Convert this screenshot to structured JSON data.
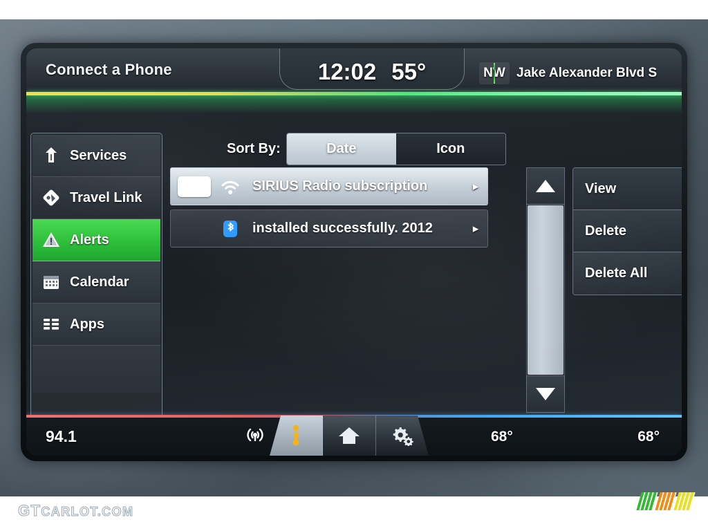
{
  "header": {
    "title": "Connect a Phone",
    "clock": "12:02",
    "outside_temp": "55°",
    "compass": "NW",
    "street": "Jake Alexander Blvd S"
  },
  "sidebar": {
    "items": [
      {
        "label": "Services",
        "icon": "road-sign-icon",
        "active": false
      },
      {
        "label": "Travel Link",
        "icon": "diamond-map-icon",
        "active": false
      },
      {
        "label": "Alerts",
        "icon": "warning-triangle-icon",
        "active": true
      },
      {
        "label": "Calendar",
        "icon": "calendar-icon",
        "active": false
      },
      {
        "label": "Apps",
        "icon": "apps-grid-icon",
        "active": false
      }
    ]
  },
  "sort": {
    "label": "Sort By:",
    "options": [
      {
        "label": "Date",
        "selected": true
      },
      {
        "label": "Icon",
        "selected": false
      }
    ]
  },
  "messages": [
    {
      "text": "SIRIUS Radio subscription",
      "icon": "sirius-signal-icon",
      "thumbnail": true,
      "selected": true,
      "chevron": "▸"
    },
    {
      "text": "installed successfully. 2012",
      "icon": "bluetooth-icon",
      "thumbnail": false,
      "selected": false,
      "chevron": "▸"
    }
  ],
  "scrollbar": {
    "up_icon": "triangle-up-icon",
    "down_icon": "triangle-down-icon"
  },
  "actions": [
    {
      "label": "View"
    },
    {
      "label": "Delete"
    },
    {
      "label": "Delete All"
    }
  ],
  "footer": {
    "radio_station": "94.1",
    "antenna_icon": "satellite-radio-icon",
    "tabs": [
      {
        "icon": "info-icon",
        "active": true
      },
      {
        "icon": "home-icon",
        "active": false
      },
      {
        "icon": "gears-icon",
        "active": false
      }
    ],
    "temp_left": "68°",
    "temp_right": "68°"
  },
  "watermark": {
    "prefix": "GT",
    "suffix": "CARLOT.COM"
  },
  "colors": {
    "accent_green": "#3cc84a",
    "header_rule_left": "#f0e14a",
    "header_rule_right": "#4fe87a",
    "footer_rule_left": "#f07070",
    "footer_rule_right": "#3fa8f5",
    "info_icon": "#f5b21a",
    "bluetooth": "#2f9bff",
    "stripe_green": "#35b935",
    "stripe_orange": "#f08c18",
    "stripe_yellow": "#e8e020"
  }
}
